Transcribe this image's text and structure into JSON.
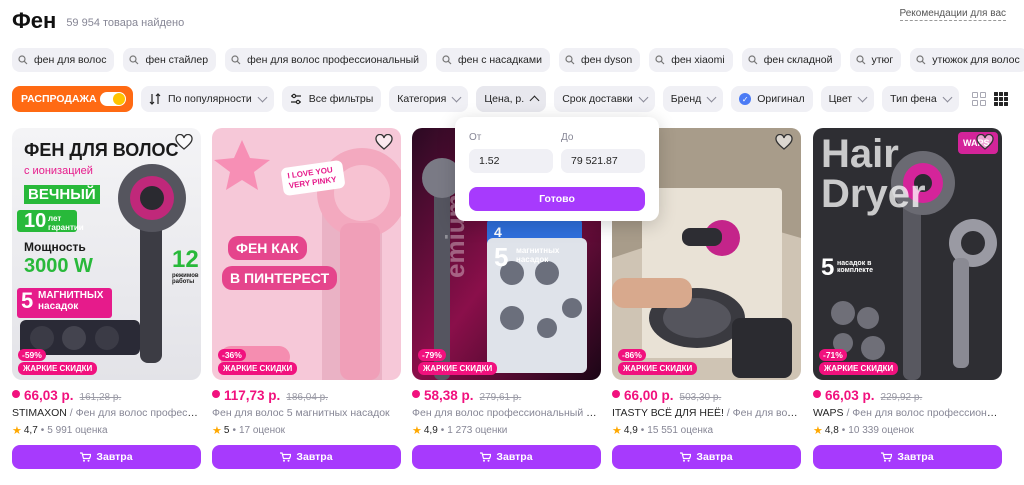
{
  "header": {
    "title": "Фен",
    "count": "59 954 товара найдено",
    "recommendations": "Рекомендации для вас"
  },
  "suggestions": [
    "фен для волос",
    "фен стайлер",
    "фен для волос профессиональный",
    "фен с насадками",
    "фен dyson",
    "фен xiaomi",
    "фен складной",
    "утюг",
    "утюжок для волос"
  ],
  "filters": {
    "sale": "РАСПРОДАЖА",
    "sort": "По популярности",
    "all_filters": "Все фильтры",
    "category": "Категория",
    "price": "Цена, р.",
    "delivery": "Срок доставки",
    "brand": "Бренд",
    "original": "Оригинал",
    "color": "Цвет",
    "type": "Тип фена"
  },
  "price_popup": {
    "from_label": "От",
    "to_label": "До",
    "from_value": "1.52",
    "to_value": "79 521.87",
    "done": "Готово"
  },
  "products": [
    {
      "price": "66,03 р.",
      "old_price": "161,28 р.",
      "brand": "STIMAXON",
      "desc": "Фен для волос профессио...",
      "rating": "4,7",
      "reviews": "5 991 оценка",
      "discount": "-59%",
      "hot": "ЖАРКИЕ СКИДКИ",
      "buy": "Завтра",
      "image_text": {
        "l1": "ФЕН ДЛЯ ВОЛОС",
        "l2": "с ионизацией",
        "l3": "ВЕЧНЫЙ",
        "l4": "10",
        "l4b": "лет гарантии",
        "l5": "Мощность",
        "l6": "3000 W",
        "l7": "5",
        "l7b": "МАГНИТНЫХ насадок",
        "l8": "12",
        "l8b": "режимов работы"
      }
    },
    {
      "price": "117,73 р.",
      "old_price": "186,04 р.",
      "brand": "",
      "desc": "Фен для волос 5 магнитных насадок",
      "rating": "5",
      "reviews": "17 оценок",
      "discount": "-36%",
      "hot": "ЖАРКИЕ СКИДКИ",
      "buy": "Завтра",
      "image_text": {
        "l1": "I LOVE YOU VERY PINKY",
        "l2": "ФЕН КАК",
        "l3": "В ПИНТЕРЕСТ"
      }
    },
    {
      "price": "58,38 р.",
      "old_price": "279,61 р.",
      "brand": "",
      "desc": "Фен для волос профессиональный с на...",
      "rating": "4,9",
      "reviews": "1 273 оценки",
      "discount": "-79%",
      "hot": "ЖАРКИЕ СКИДКИ",
      "buy": "Завтра",
      "image_text": {
        "l1": "4",
        "l2": "5",
        "l2b": "магнитных насадок",
        "l3": "emium"
      }
    },
    {
      "price": "66,00 р.",
      "old_price": "503,30 р.",
      "brand": "ITASTY ВСЁ ДЛЯ НЕЁ!",
      "desc": "Фен для волос п...",
      "rating": "4,9",
      "reviews": "15 551 оценка",
      "discount": "-86%",
      "hot": "ЖАРКИЕ СКИДКИ",
      "buy": "Завтра"
    },
    {
      "price": "66,03 р.",
      "old_price": "229,92 р.",
      "brand": "WAPS",
      "desc": "Фен для волос профессиональны...",
      "rating": "4,8",
      "reviews": "10 339 оценок",
      "discount": "-71%",
      "hot": "ЖАРКИЕ СКИДКИ",
      "buy": "Завтра",
      "image_text": {
        "l1": "Hair",
        "l2": "Dryer",
        "l3": "5",
        "l3b": "насадок в комплекте",
        "l4": "WAPS"
      }
    }
  ],
  "colors": {
    "accent": "#a73afd",
    "sale": "#ff6a13",
    "price": "#f1117e",
    "star": "#ffa800",
    "chip_bg": "#f0f0f5"
  },
  "icons": [
    "search-icon",
    "sort-icon",
    "filter-icon",
    "chevron-down-icon",
    "chevron-up-icon",
    "check-icon",
    "grid-large-icon",
    "grid-small-icon",
    "heart-icon",
    "cart-icon",
    "star-icon"
  ]
}
